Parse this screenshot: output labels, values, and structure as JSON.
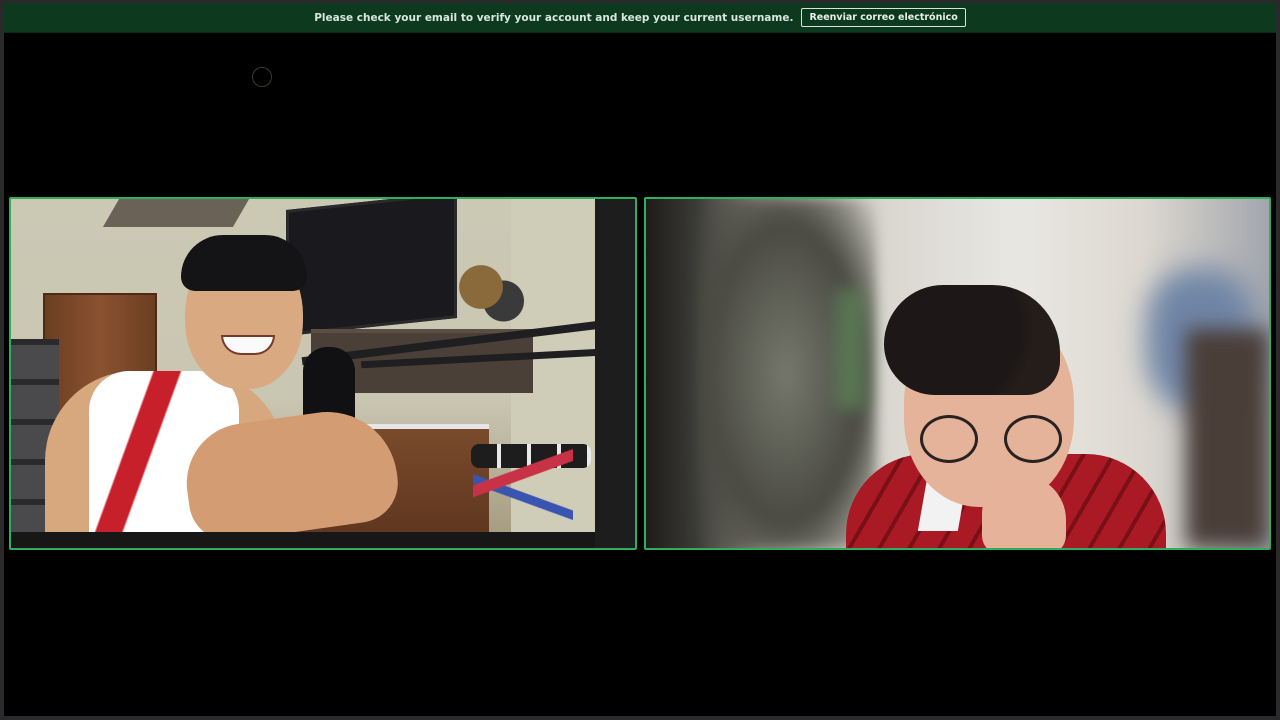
{
  "notice": {
    "message": "Please check your email to verify your account and keep your current username.",
    "button_label": "Reenviar correo electrónico"
  },
  "colors": {
    "notice_background": "#0d3a1f",
    "active_speaker_border": "#2fae5c",
    "stage_background": "#000000"
  },
  "participants": [
    {
      "tile": "left",
      "description_icon": "video-feed"
    },
    {
      "tile": "right",
      "description_icon": "video-feed"
    }
  ]
}
